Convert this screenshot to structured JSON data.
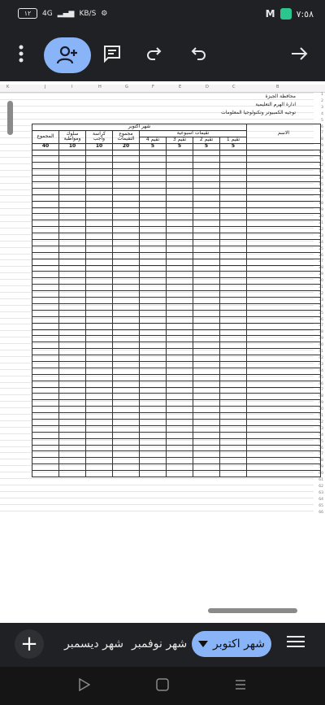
{
  "status": {
    "time": "٧:٥٨",
    "battery": "١٢",
    "network": "4G",
    "speed": "KB/S"
  },
  "sheet": {
    "col_headers": [
      "K",
      "J",
      "I",
      "H",
      "G",
      "F",
      "E",
      "D",
      "C",
      "B"
    ],
    "header_lines": [
      "محافظة الجيزة",
      "ادارة الهرم التعليمية",
      "توجيه الكمبيوتر وتكنولوجيا المعلومات"
    ],
    "month_title": "شهر اكتوبر",
    "weekly_title": "تقيمات اسبوعية",
    "name_col": "الاسم",
    "headers": [
      "تقيم 1",
      "تقيم 2",
      "تقيم 3",
      "تقيم 4",
      "مجموع التقيمات",
      "كراسة واجب",
      "سلوك ومواظبة",
      "المجموع"
    ],
    "max_scores": [
      "5",
      "5",
      "5",
      "5",
      "20",
      "10",
      "10",
      "40"
    ],
    "row_count": 66
  },
  "tabs": {
    "active": "شهر اكتوبر",
    "items": [
      "شهر نوفمبر",
      "شهر ديسمبر"
    ]
  },
  "colors": {
    "accent": "#8ab4f8",
    "bar": "#202124"
  }
}
